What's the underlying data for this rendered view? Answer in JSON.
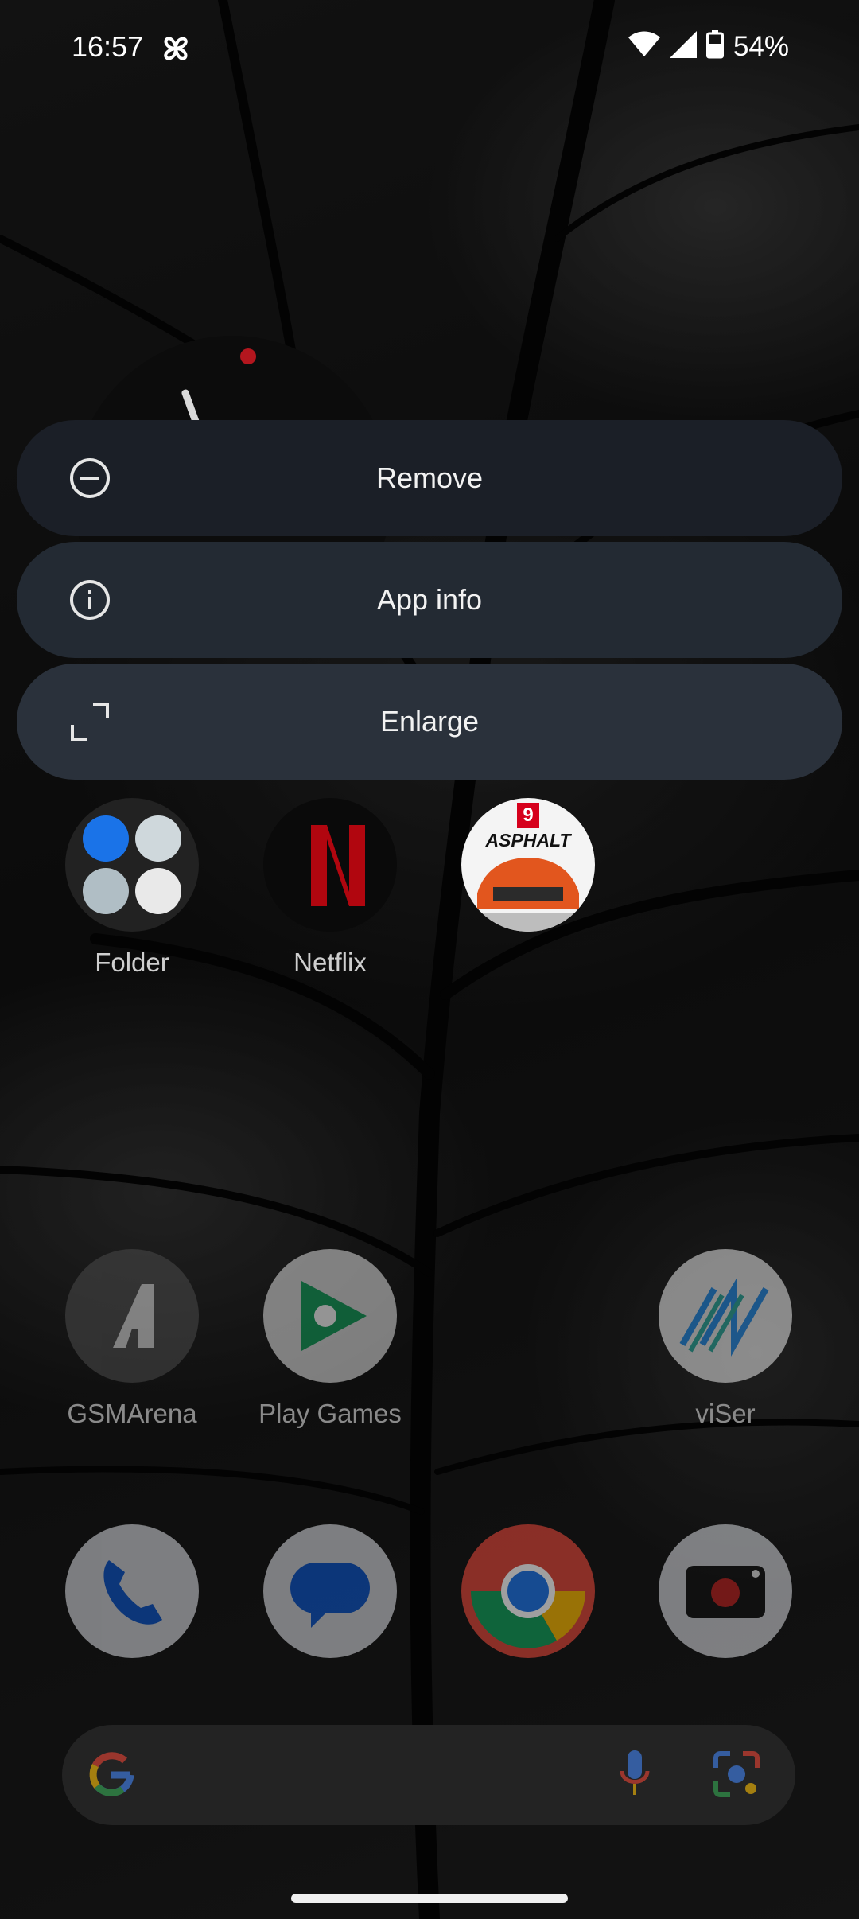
{
  "status_bar": {
    "time": "16:57",
    "battery_percent": "54%",
    "icons": [
      "pinwheel-icon",
      "wifi-icon",
      "signal-icon",
      "battery-icon"
    ]
  },
  "popup_menu": {
    "items": [
      {
        "label": "Remove",
        "icon": "remove-circle-icon"
      },
      {
        "label": "App info",
        "icon": "info-icon"
      },
      {
        "label": "Enlarge",
        "icon": "expand-corners-icon"
      }
    ]
  },
  "home_apps": [
    {
      "label": "Folder",
      "icon": "folder-icon"
    },
    {
      "label": "Netflix",
      "icon": "netflix-icon"
    },
    {
      "label": "",
      "icon": "asphalt-9-icon",
      "logo_text": "ASPHALT",
      "logo_number": "9"
    },
    {
      "label": "GSMArena",
      "icon": "gsmarena-icon"
    },
    {
      "label": "Play Games",
      "icon": "play-games-icon"
    },
    {
      "label": "viSer",
      "icon": "viser-icon"
    }
  ],
  "dock": [
    {
      "icon": "phone-icon"
    },
    {
      "icon": "messages-icon"
    },
    {
      "icon": "chrome-icon"
    },
    {
      "icon": "camera-icon"
    }
  ],
  "search_bar": {
    "icons": [
      "google-g-icon",
      "mic-icon",
      "lens-icon"
    ]
  },
  "colors": {
    "menu_bg_1": "#1b1f27",
    "menu_bg_2": "#232a33",
    "menu_bg_3": "#2a313b",
    "netflix_red": "#b1060f"
  }
}
